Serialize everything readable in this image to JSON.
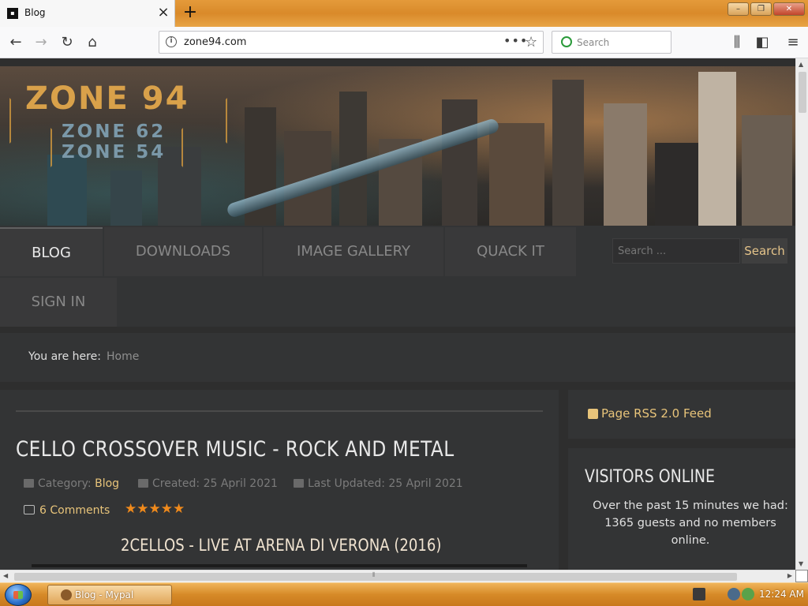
{
  "browser": {
    "tab_title": "Blog",
    "new_tab": "+",
    "url": "zone94.com",
    "search_placeholder": "Search",
    "window_buttons": [
      "–",
      "❐",
      "✕"
    ]
  },
  "site": {
    "logo_main": "ZONE 94",
    "logo_sub1": "ZONE 62",
    "logo_sub2": "ZONE 54",
    "menu": [
      {
        "label": "BLOG"
      },
      {
        "label": "DOWNLOADS"
      },
      {
        "label": "IMAGE GALLERY"
      },
      {
        "label": "QUACK IT"
      },
      {
        "label": "SIGN IN"
      }
    ],
    "search_placeholder": "Search ...",
    "search_button": "Search"
  },
  "breadcrumb": {
    "label": "You are here:",
    "home": "Home"
  },
  "article": {
    "title": "CELLO CROSSOVER MUSIC - ROCK AND METAL",
    "category_label": "Category:",
    "category": "Blog",
    "created": "Created: 25 April 2021",
    "updated": "Last Updated: 25 April 2021",
    "comments": "6 Comments",
    "rating_stars": "★★★★★",
    "rating": 5,
    "subtitle": "2CELLOS - LIVE AT ARENA DI VERONA (2016)"
  },
  "sidebar": {
    "rss": "Page RSS 2.0 Feed",
    "visitors_title": "VISITORS ONLINE",
    "visitors_text": "Over the past 15 minutes we had: 1365 guests and no members online."
  },
  "taskbar": {
    "task_label": "Blog - Mypal",
    "clock": "12:24 AM"
  },
  "colors": {
    "accent": "#e8c47a",
    "page_bg": "#2e2e2e",
    "star": "#f08a1c",
    "taskbar": "#d68a28"
  }
}
